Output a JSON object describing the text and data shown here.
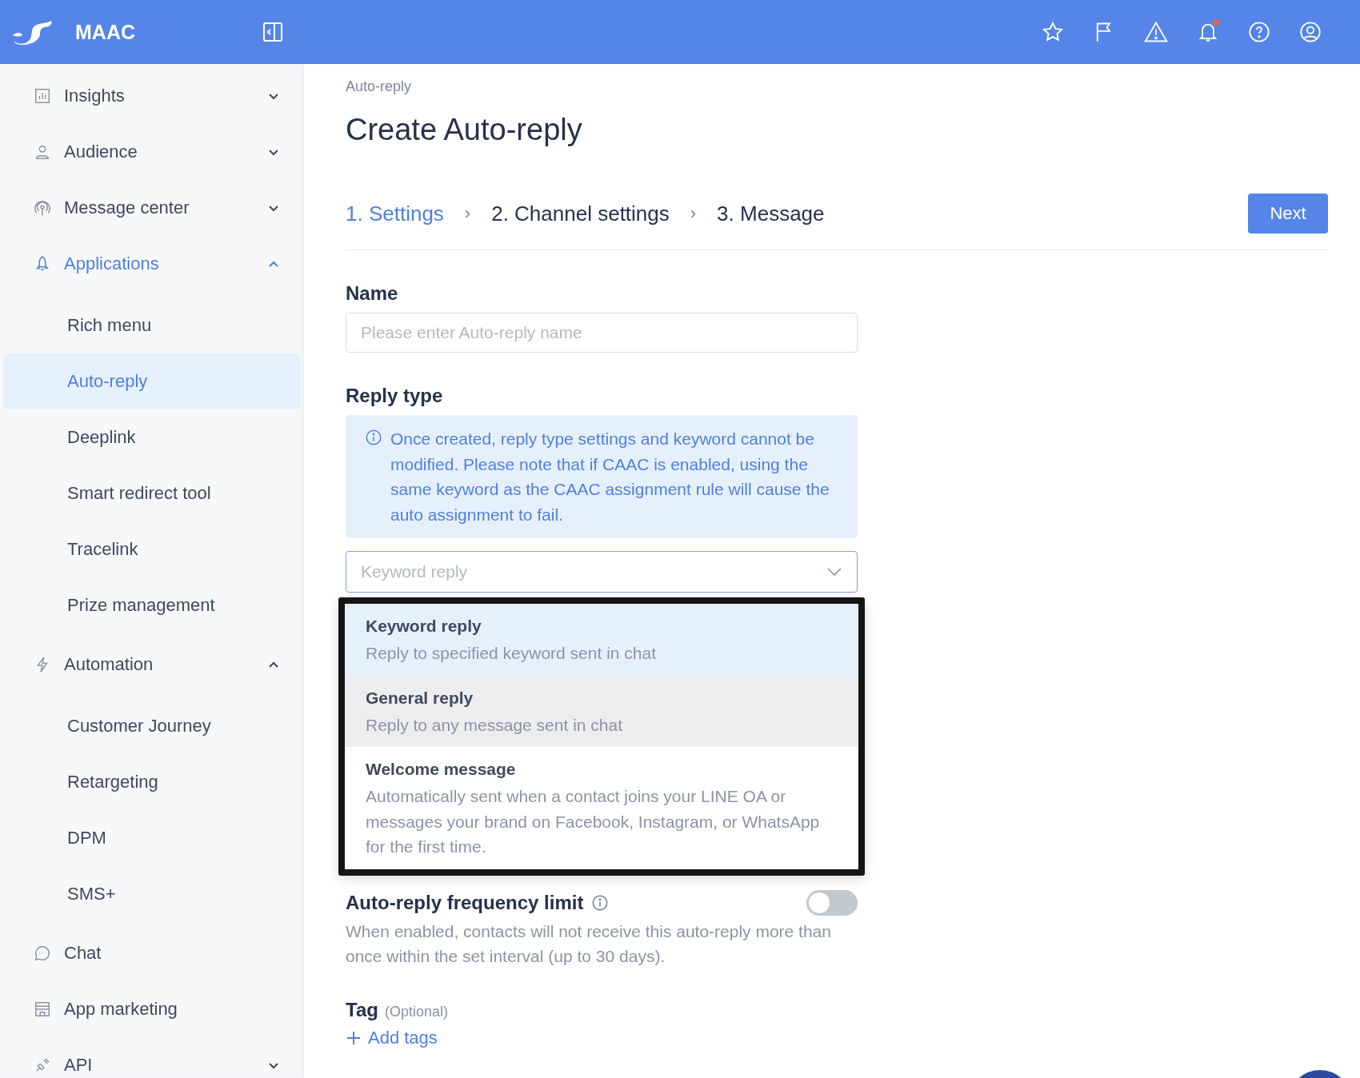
{
  "header": {
    "brand": "MAAC",
    "notification_badge": true
  },
  "sidebar": {
    "items": [
      {
        "label": "Insights",
        "selected": false,
        "expanded": false
      },
      {
        "label": "Audience",
        "selected": false,
        "expanded": false
      },
      {
        "label": "Message center",
        "selected": false,
        "expanded": false
      },
      {
        "label": "Applications",
        "selected": true,
        "expanded": true,
        "children": [
          {
            "label": "Rich menu",
            "selected": false
          },
          {
            "label": "Auto-reply",
            "selected": true
          },
          {
            "label": "Deeplink",
            "selected": false
          },
          {
            "label": "Smart redirect tool",
            "selected": false
          },
          {
            "label": "Tracelink",
            "selected": false
          },
          {
            "label": "Prize management",
            "selected": false
          }
        ]
      },
      {
        "label": "Automation",
        "selected": false,
        "expanded": true,
        "children": [
          {
            "label": "Customer Journey",
            "selected": false
          },
          {
            "label": "Retargeting",
            "selected": false
          },
          {
            "label": "DPM",
            "selected": false
          },
          {
            "label": "SMS+",
            "selected": false
          }
        ]
      },
      {
        "label": "Chat",
        "selected": false
      },
      {
        "label": "App marketing",
        "selected": false
      },
      {
        "label": "API",
        "selected": false,
        "expanded": false
      }
    ]
  },
  "breadcrumb": "Auto-reply",
  "title": "Create Auto-reply",
  "steps": [
    {
      "label": "1. Settings",
      "selected": true
    },
    {
      "label": "2. Channel settings",
      "selected": false
    },
    {
      "label": "3. Message",
      "selected": false
    }
  ],
  "step_separator": "›",
  "next_button": "Next",
  "name_field": {
    "label": "Name",
    "placeholder": "Please enter Auto-reply name"
  },
  "reply_type": {
    "label": "Reply type",
    "notice": "Once created, reply type settings and keyword cannot be modified. Please note that if CAAC is enabled, using the same keyword as the CAAC assignment rule will cause the auto assignment to fail.",
    "placeholder": "Keyword reply",
    "options": [
      {
        "title": "Keyword reply",
        "description": "Reply to specified keyword sent in chat",
        "selected": true,
        "hovered": false
      },
      {
        "title": "General reply",
        "description": "Reply to any message sent in chat",
        "selected": false,
        "hovered": true
      },
      {
        "title": "Welcome message",
        "description": "Automatically sent when a contact joins your LINE OA or messages your brand on Facebook, Instagram, or WhatsApp for the first time.",
        "selected": false,
        "hovered": false
      }
    ]
  },
  "frequency_limit": {
    "label": "Auto-reply frequency limit",
    "on": false,
    "description": "When enabled, contacts will not receive this auto-reply more than once within the set interval (up to 30 days)."
  },
  "tag": {
    "label": "Tag",
    "hint": "(Optional)",
    "add_link": "Add tags"
  }
}
